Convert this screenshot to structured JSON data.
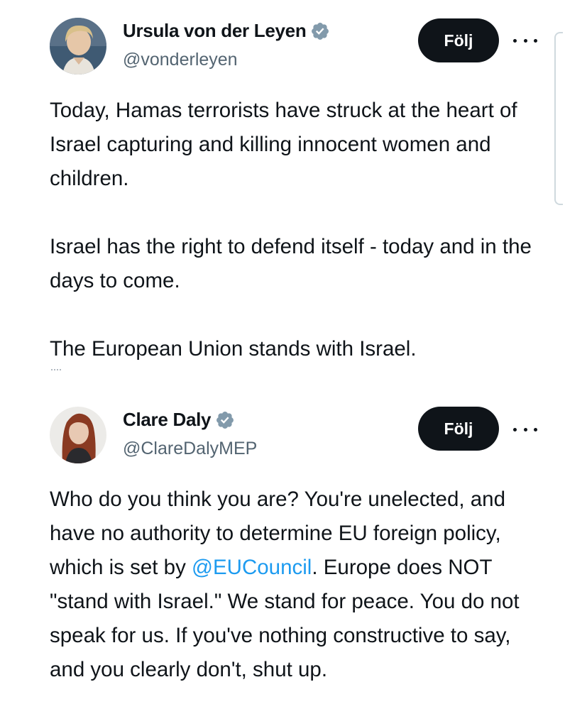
{
  "tweets": [
    {
      "display_name": "Ursula von der Leyen",
      "handle": "@vonderleyen",
      "follow_label": "Följ",
      "avatar_icon": "avatar-photo",
      "verified_icon": "verified-badge-icon",
      "body": {
        "p1": "Today, Hamas terrorists have struck at the heart of Israel capturing and killing innocent women and children.",
        "p2": "Israel has the right to defend itself - today and in the days to come.",
        "p3": "The European Union stands with Israel."
      }
    },
    {
      "display_name": "Clare Daly",
      "handle": "@ClareDalyMEP",
      "follow_label": "Följ",
      "avatar_icon": "avatar-photo",
      "verified_icon": "verified-badge-icon",
      "body": {
        "before_mention": "Who do you think you are? You're unelected, and have no authority to determine EU foreign policy, which is set by ",
        "mention": "@EUCouncil",
        "after_mention": ". Europe does NOT \"stand with Israel.\" We stand for peace. You do not speak for us. If you've nothing constructive to say, and you clearly don't, shut up."
      }
    }
  ],
  "colors": {
    "text": "#0f1419",
    "secondary_text": "#536471",
    "mention": "#1d9bf0",
    "button_bg": "#0f1419",
    "verified_badge": "#829aab"
  }
}
